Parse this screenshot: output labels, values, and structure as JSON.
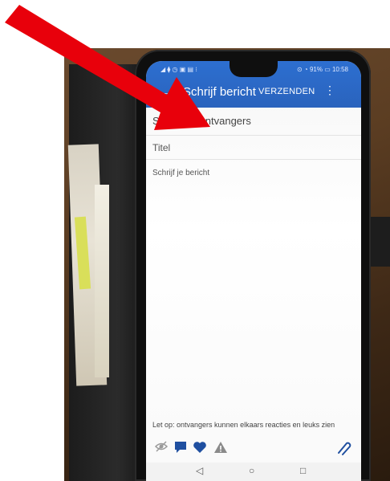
{
  "status_bar": {
    "left": "◢ ⧫ ◷ ▣ ▤ ⁝",
    "right": "⊙ ◔ 91% ▭ 10:58"
  },
  "appbar": {
    "title": "Schrijf bericht",
    "send_label": "VERZENDEN",
    "more_label": "⋮",
    "back_label": "←"
  },
  "compose": {
    "recipients_placeholder": "Selecteer ontvangers",
    "title_placeholder": "Titel",
    "body_placeholder": "Schrijf je bericht"
  },
  "notice": "Let op: ontvangers kunnen elkaars reacties en leuks zien",
  "toolbar": {
    "hide_icon": "eye-slash-icon",
    "comment_icon": "speech-bubble-icon",
    "heart_icon": "heart-icon",
    "warning_icon": "warning-triangle-icon",
    "attach_icon": "paperclip-icon"
  },
  "navbar": {
    "back": "◁",
    "home": "○",
    "recents": "□"
  },
  "colors": {
    "appbar": "#2d6fd0",
    "icon_blue": "#1f4fa0",
    "arrow_red": "#e8000b"
  }
}
